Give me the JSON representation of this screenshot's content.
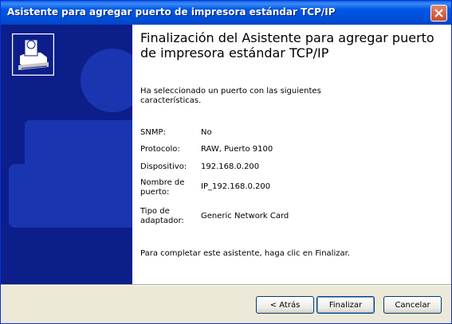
{
  "window": {
    "title": "Asistente para agregar puerto de impresora estándar TCP/IP"
  },
  "main": {
    "heading": "Finalización del Asistente para agregar puerto de impresora estándar TCP/IP",
    "intro": "Ha seleccionado un puerto con las siguientes características.",
    "details": [
      {
        "label": "SNMP:",
        "value": "No"
      },
      {
        "label": "Protocolo:",
        "value": "RAW, Puerto 9100"
      },
      {
        "label": "Dispositivo:",
        "value": "192.168.0.200"
      },
      {
        "label": "Nombre de puerto:",
        "value": "IP_192.168.0.200"
      },
      {
        "label": "Tipo de adaptador:",
        "value": "Generic Network Card"
      }
    ],
    "closing": "Para completar este asistente, haga clic en Finalizar."
  },
  "buttons": {
    "back": "< Atrás",
    "finish": "Finalizar",
    "cancel": "Cancelar"
  },
  "colors": {
    "titlebar": "#0054e3",
    "panel": "#0c1e8a",
    "dialog": "#ece9d8"
  }
}
